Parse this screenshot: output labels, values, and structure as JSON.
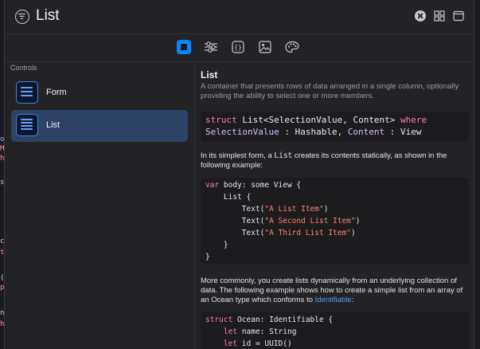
{
  "window": {
    "title": "List",
    "icons": [
      "filter-icon",
      "clear-icon",
      "grid-icon",
      "sidebar-icon"
    ]
  },
  "toolbar": {
    "tabs": [
      "inspector-icon",
      "sliders-icon",
      "braces-icon",
      "image-icon",
      "palette-icon"
    ],
    "active_tab": "inspector-icon"
  },
  "sidebar": {
    "header": "Controls",
    "items": [
      {
        "label": "Form",
        "selected": false
      },
      {
        "label": "List",
        "selected": true
      }
    ]
  },
  "content": {
    "title": "List",
    "description": "A container that presents rows of data arranged in a single column, optionally providing the ability to select one or more members.",
    "declaration": {
      "line1": [
        "struct",
        " List<SelectionValue, Content> ",
        "where"
      ],
      "line2": [
        "SelectionValue",
        " : Hashable, ",
        "Content",
        " : View"
      ]
    },
    "para1": {
      "before": "In its simplest form, a ",
      "code": "List",
      "after": " creates its contents statically, as shown in the following example:"
    },
    "example1": {
      "l1_kw": "var",
      "l1_rest": " body: some View {",
      "l2": "    List {",
      "l3_pre": "        Text(",
      "l3_str": "\"A List Item\"",
      "l3_post": ")",
      "l4_pre": "        Text(",
      "l4_str": "\"A Second List Item\"",
      "l4_post": ")",
      "l5_pre": "        Text(",
      "l5_str": "\"A Third List Item\"",
      "l5_post": ")",
      "l6": "    }",
      "l7": "}"
    },
    "para2": {
      "before": "More commonly, you create lists dynamically from an underlying collection of data. The following example shows how to create a simple list from an array of an Ocean type which conforms to ",
      "link": "Identifiable",
      "after": ":"
    },
    "example2": {
      "l1_kw": "struct",
      "l1_rest": " Ocean: Identifiable {",
      "l2_kw": "let",
      "l2_rest": " name: String",
      "l3_kw": "let",
      "l3_rest": " id = UUID()",
      "l4": "}"
    }
  },
  "colors": {
    "accent": "#0a84ff",
    "keyword": "#ff7ab2",
    "string": "#ff8170",
    "link": "#4da3ff",
    "selection": "#2d4366"
  }
}
